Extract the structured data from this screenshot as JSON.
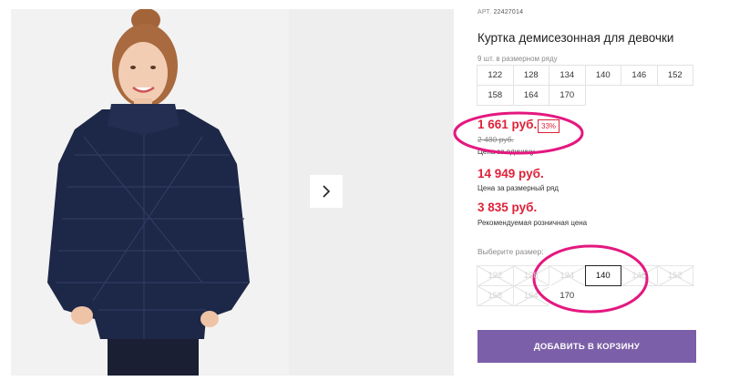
{
  "gallery": {
    "next_arrow_icon": "chevron-right-icon"
  },
  "product": {
    "sku_label": "АРТ.",
    "sku": "22427014",
    "title": "Куртка демисезонная для девочки",
    "pack_note": "9 шт. в размерном ряду",
    "sizes_row1": [
      "122",
      "128",
      "134",
      "140",
      "146",
      "152"
    ],
    "sizes_row2": [
      "158",
      "164",
      "170"
    ]
  },
  "pricing": {
    "unit_price": "1 661 руб.",
    "discount": "33%",
    "old_price": "2 480 руб.",
    "unit_label": "Цена за единицу",
    "row_price": "14 949 руб.",
    "row_label": "Цена за размерный ряд",
    "rrp_price": "3 835 руб.",
    "rrp_label": "Рекомендуемая розничная цена"
  },
  "size_picker": {
    "label": "Выберите размер:",
    "row1": [
      {
        "size": "122",
        "available": false
      },
      {
        "size": "128",
        "available": false
      },
      {
        "size": "134",
        "available": false
      },
      {
        "size": "140",
        "available": true,
        "selected": true
      },
      {
        "size": "146",
        "available": false
      },
      {
        "size": "152",
        "available": false
      }
    ],
    "row2": [
      {
        "size": "158",
        "available": false
      },
      {
        "size": "164",
        "available": false
      },
      {
        "size": "170",
        "available": true
      }
    ]
  },
  "cart": {
    "button_label": "ДОБАВИТЬ В КОРЗИНУ"
  },
  "colors": {
    "price_red": "#e0213a",
    "button_purple": "#7b5fa8",
    "annotation_magenta": "#e4187f"
  }
}
